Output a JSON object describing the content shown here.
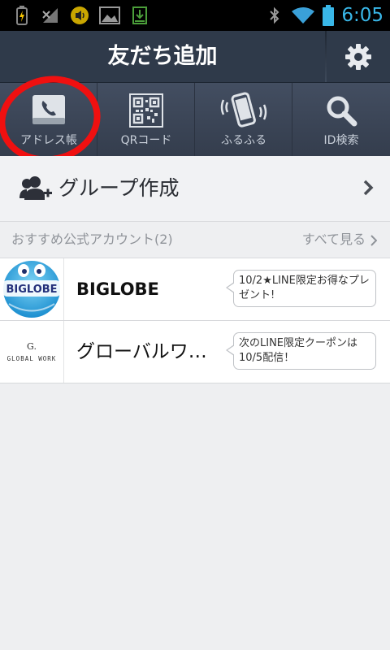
{
  "statusbar": {
    "time": "6:05",
    "icons": [
      "charging-icon",
      "no-sim-icon",
      "sound-icon",
      "image-icon",
      "download-icon",
      "bluetooth-icon",
      "wifi-icon",
      "battery-icon"
    ]
  },
  "header": {
    "title": "友だち追加",
    "settings_icon": "gear-icon"
  },
  "tabs": [
    {
      "label": "アドレス帳",
      "icon": "phone-book-icon"
    },
    {
      "label": "QRコード",
      "icon": "qr-code-icon"
    },
    {
      "label": "ふるふる",
      "icon": "shake-phone-icon"
    },
    {
      "label": "ID検索",
      "icon": "search-icon"
    }
  ],
  "group": {
    "label": "グループ作成"
  },
  "section": {
    "title": "おすすめ公式アカウント(2)",
    "see_all": "すべて見る"
  },
  "accounts": [
    {
      "name": "BIGLOBE",
      "logo_text": "BIGLOBE",
      "message": "10/2★LINE限定お得なプレゼント!"
    },
    {
      "name": "グローバルワ…",
      "logo_text_top": "G.",
      "logo_text": "GLOBAL WORK",
      "message": "次のLINE限定クーポンは10/5配信！"
    }
  ],
  "colors": {
    "header_bg": "#2f3a4a",
    "tab_bg": "#3a4456",
    "accent_time": "#39b7e8",
    "annotation_circle": "#f01010"
  }
}
